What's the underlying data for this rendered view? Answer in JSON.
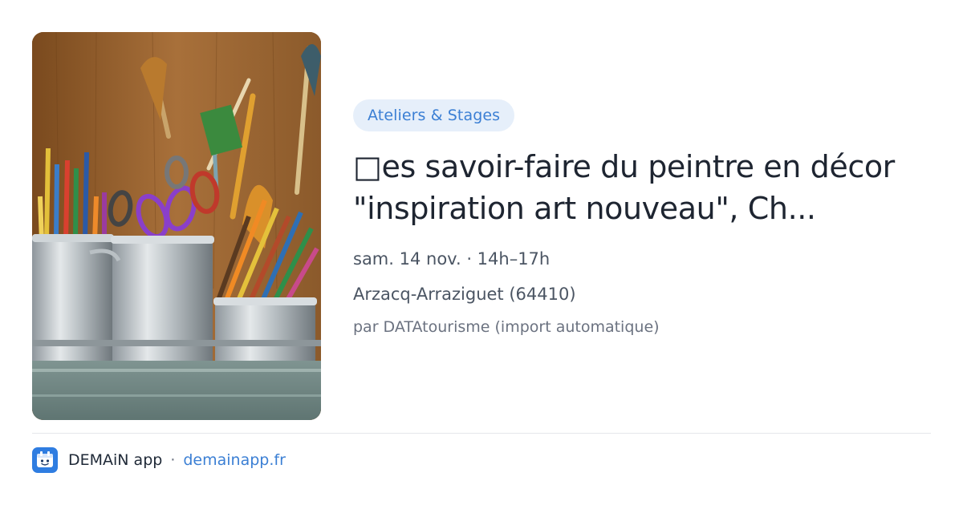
{
  "card": {
    "image_alt": "Pots de crayons de couleur, pinceaux et ciseaux",
    "category": "Ateliers & Stages",
    "title": "□es savoir-faire du peintre en décor \"inspiration art nouveau\", Ch...",
    "date": "sam. 14 nov. · 14h–17h",
    "location": "Arzacq-Arraziguet (64410)",
    "author": "par DATAtourisme (import automatique)"
  },
  "footer": {
    "app_name": "DEMAiN app",
    "separator": "·",
    "domain": "demainapp.fr",
    "logo_icon": "calendar-face-icon"
  },
  "colors": {
    "accent": "#3b7fd4",
    "tag_bg": "#e6effa",
    "logo_bg": "#2f7de1"
  }
}
